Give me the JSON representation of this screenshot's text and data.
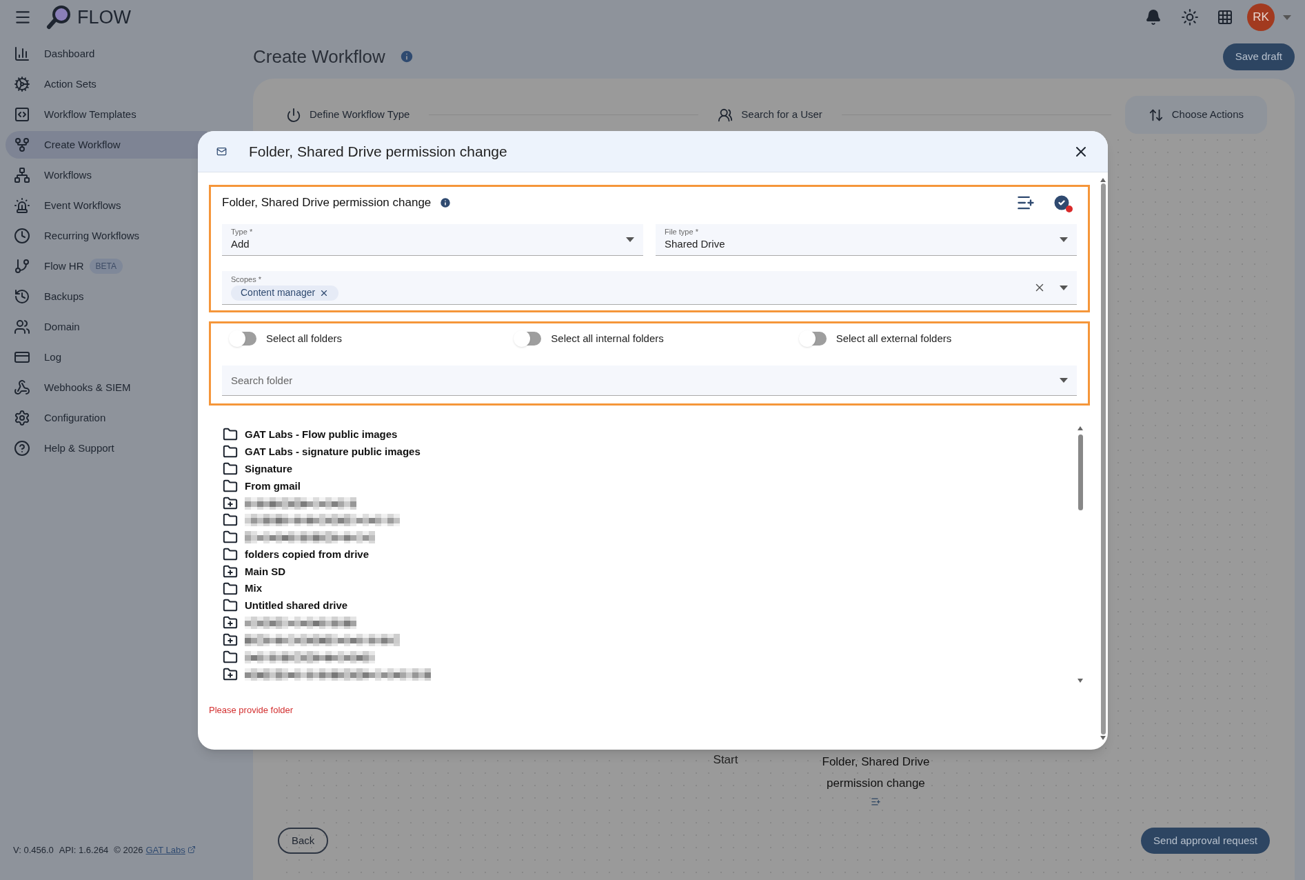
{
  "app": {
    "name": "FLOW",
    "avatar": "RK"
  },
  "sidebar": {
    "items": [
      {
        "label": "Dashboard",
        "selected": false
      },
      {
        "label": "Action Sets",
        "selected": false
      },
      {
        "label": "Workflow Templates",
        "selected": false
      },
      {
        "label": "Create Workflow",
        "selected": true
      },
      {
        "label": "Workflows",
        "selected": false
      },
      {
        "label": "Event Workflows",
        "selected": false
      },
      {
        "label": "Recurring Workflows",
        "selected": false
      },
      {
        "label": "Flow HR",
        "badge": "BETA",
        "selected": false
      },
      {
        "label": "Backups",
        "selected": false
      },
      {
        "label": "Domain",
        "selected": false
      },
      {
        "label": "Log",
        "selected": false
      },
      {
        "label": "Webhooks & SIEM",
        "selected": false
      },
      {
        "label": "Configuration",
        "selected": false
      },
      {
        "label": "Help & Support",
        "selected": false
      }
    ]
  },
  "footer": {
    "version": "V: 0.456.0",
    "api": "API: 1.6.264",
    "copyright": "© 2026",
    "link": "GAT Labs"
  },
  "page": {
    "title": "Create Workflow",
    "save_button": "Save draft"
  },
  "stepper": [
    {
      "label": "Define Workflow Type",
      "selected": false
    },
    {
      "label": "Search for a User",
      "selected": false
    },
    {
      "label": "Choose Actions",
      "selected": true
    }
  ],
  "canvas": {
    "nodes": [
      {
        "label": "Start"
      },
      {
        "label": "Folder, Shared Drive permission change"
      }
    ]
  },
  "buttons": {
    "back": "Back",
    "send": "Send approval request"
  },
  "dialog": {
    "title": "Folder, Shared Drive permission change",
    "section_title": "Folder, Shared Drive permission change",
    "fields": [
      {
        "label": "Type *",
        "value": "Add"
      },
      {
        "label": "File type *",
        "value": "Shared Drive"
      }
    ],
    "scopes": {
      "label": "Scopes *",
      "chips": [
        "Content manager"
      ]
    },
    "toggles": [
      {
        "label": "Select all folders",
        "on": false
      },
      {
        "label": "Select all internal folders",
        "on": false
      },
      {
        "label": "Select all external folders",
        "on": false
      }
    ],
    "search": {
      "placeholder": "Search folder"
    },
    "folders": [
      {
        "kind": "folder",
        "name": "GAT Labs - Flow public images"
      },
      {
        "kind": "folder",
        "name": "GAT Labs - signature public images"
      },
      {
        "kind": "folder",
        "name": "Signature"
      },
      {
        "kind": "folder",
        "name": "From gmail"
      },
      {
        "kind": "shared",
        "redacted": true
      },
      {
        "kind": "folder",
        "redacted": true
      },
      {
        "kind": "folder",
        "redacted": true
      },
      {
        "kind": "folder",
        "name": "folders copied from drive"
      },
      {
        "kind": "shared",
        "name": "Main SD"
      },
      {
        "kind": "folder",
        "name": "Mix"
      },
      {
        "kind": "folder",
        "name": "Untitled shared drive"
      },
      {
        "kind": "shared",
        "redacted": true
      },
      {
        "kind": "shared",
        "redacted": true
      },
      {
        "kind": "folder",
        "redacted": true
      },
      {
        "kind": "shared",
        "redacted": true
      }
    ],
    "error": "Please provide folder"
  }
}
